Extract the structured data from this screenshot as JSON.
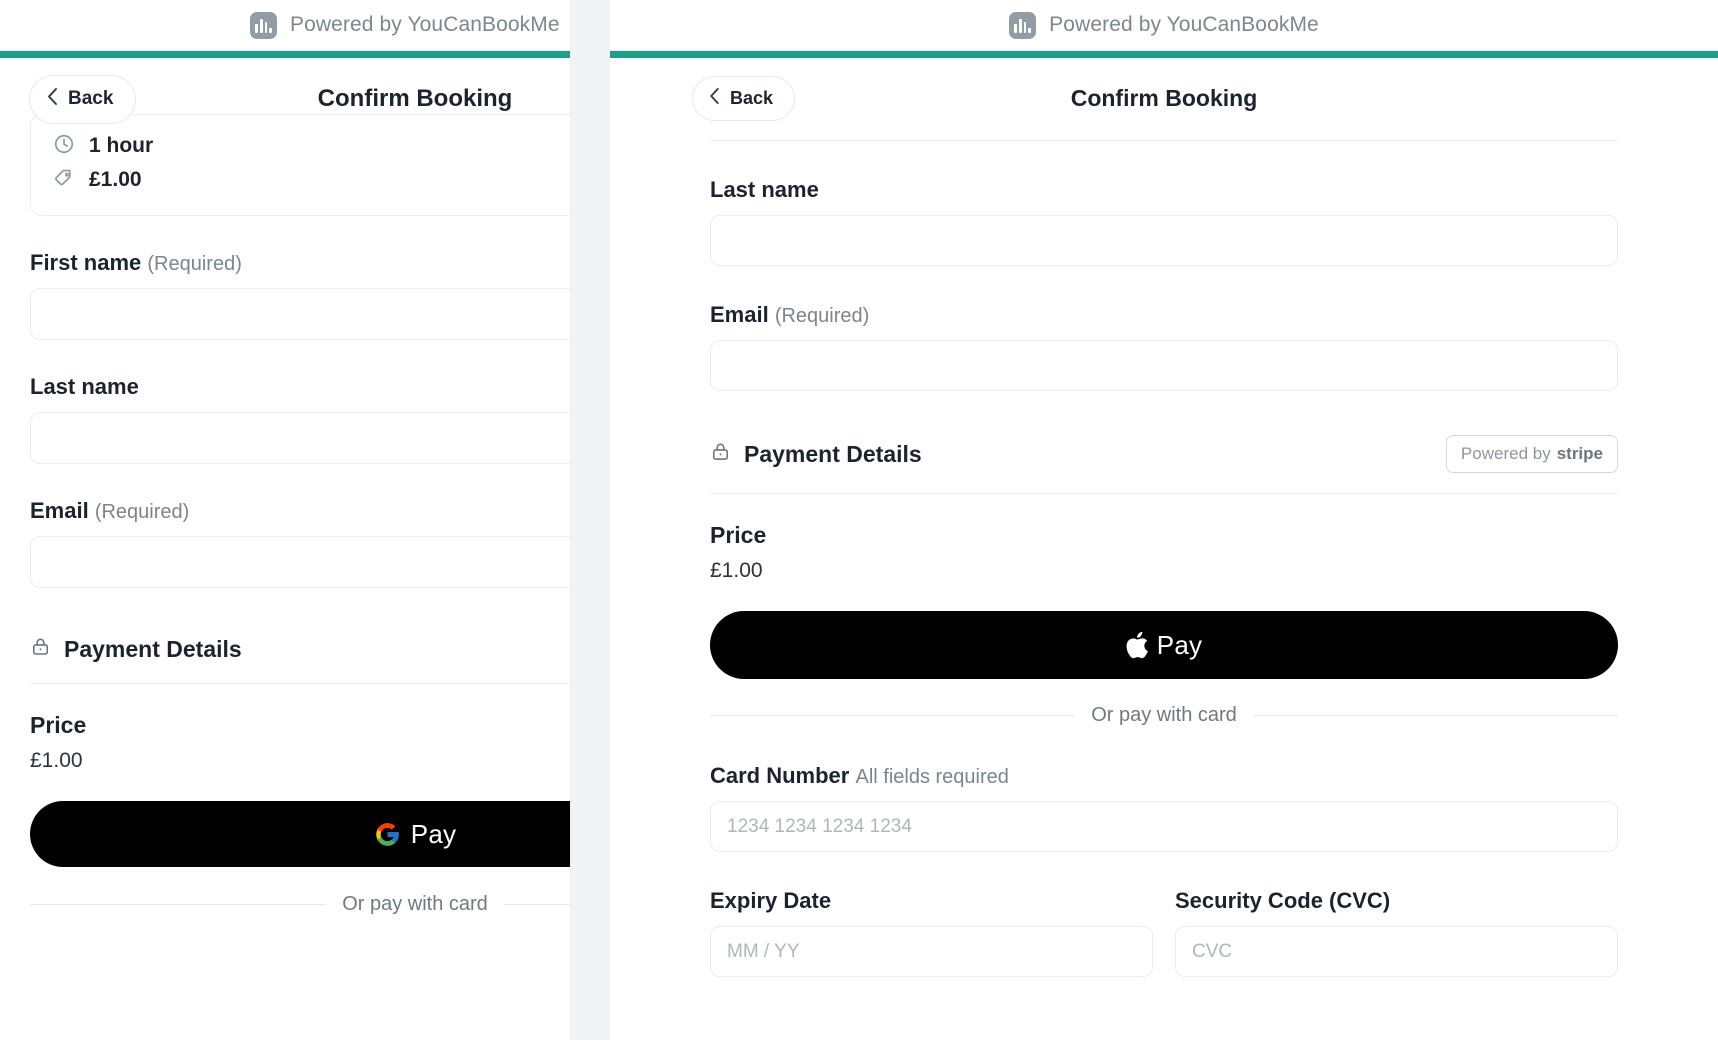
{
  "brand": {
    "powered_by": "Powered by YouCanBookMe",
    "logo_icon": "youcanbookme-logo-icon",
    "accent_color": "#1f9e8b"
  },
  "left_panel": {
    "back_label": "Back",
    "title": "Confirm Booking",
    "summary": {
      "duration_icon": "clock-icon",
      "duration": "1 hour",
      "price_icon": "tag-icon",
      "price": "£1.00"
    },
    "fields": [
      {
        "label": "First name",
        "required_note": "(Required)",
        "value": "",
        "placeholder": ""
      },
      {
        "label": "Last name",
        "required_note": "",
        "value": "",
        "placeholder": ""
      },
      {
        "label": "Email",
        "required_note": "(Required)",
        "value": "",
        "placeholder": ""
      }
    ],
    "payment": {
      "lock_icon": "lock-icon",
      "heading": "Payment Details",
      "price_label": "Price",
      "price_value": "£1.00",
      "wallet_button": {
        "icon": "google-pay-icon",
        "label": "Pay"
      },
      "or_pay_with_card": "Or pay with card"
    }
  },
  "right_panel": {
    "back_label": "Back",
    "title": "Confirm Booking",
    "fields": [
      {
        "label": "Last name",
        "required_note": "",
        "value": "",
        "placeholder": ""
      },
      {
        "label": "Email",
        "required_note": "(Required)",
        "value": "",
        "placeholder": ""
      }
    ],
    "payment": {
      "lock_icon": "lock-icon",
      "heading": "Payment Details",
      "stripe_badge": {
        "prefix": "Powered by",
        "brand": "stripe"
      },
      "price_label": "Price",
      "price_value": "£1.00",
      "wallet_button": {
        "icon": "apple-pay-icon",
        "label": "Pay"
      },
      "or_pay_with_card": "Or pay with card",
      "card_number": {
        "label": "Card Number",
        "hint": "All fields required",
        "value": "",
        "placeholder": "1234 1234 1234 1234"
      },
      "expiry": {
        "label": "Expiry Date",
        "value": "",
        "placeholder": "MM / YY"
      },
      "cvc": {
        "label": "Security Code (CVC)",
        "value": "",
        "placeholder": "CVC"
      }
    }
  }
}
